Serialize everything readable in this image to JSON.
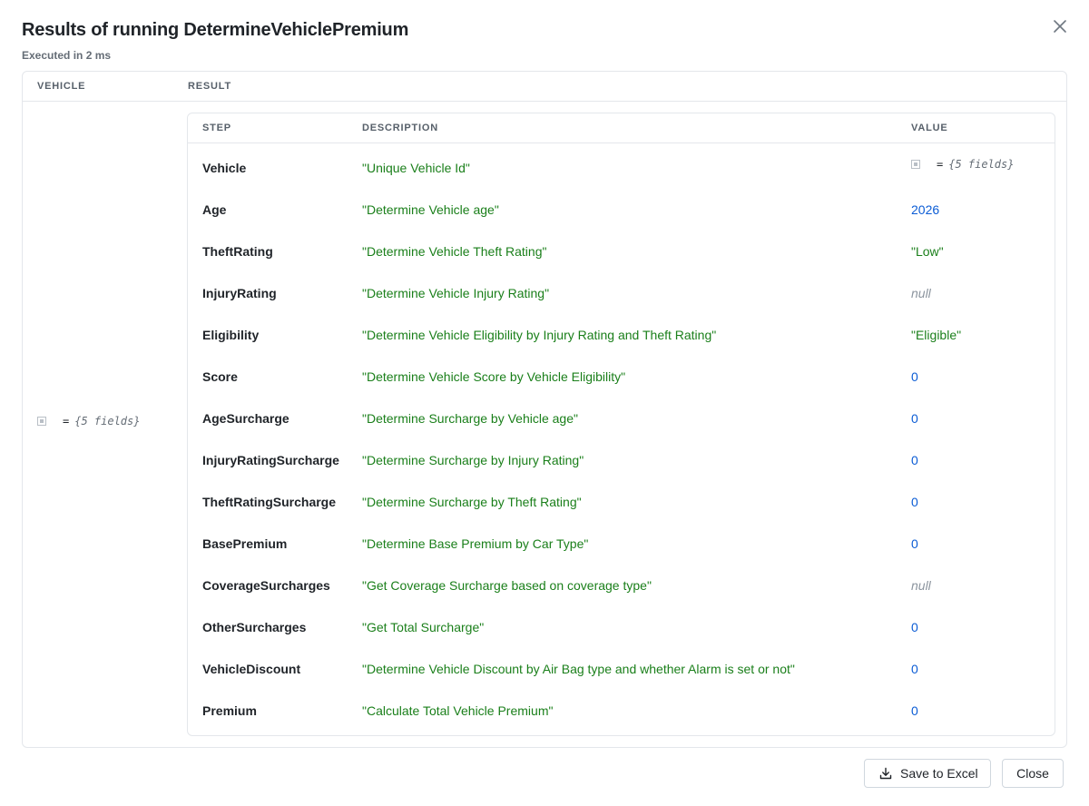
{
  "dialog": {
    "title": "Results of running DetermineVehiclePremium",
    "subtitle": "Executed in 2 ms",
    "close_icon": "close-icon"
  },
  "outer_table": {
    "columns": [
      "VEHICLE",
      "RESULT"
    ],
    "vehicle_value": {
      "eq": "=",
      "summary": "{5 fields}"
    }
  },
  "result_table": {
    "columns": [
      "STEP",
      "DESCRIPTION",
      "VALUE"
    ],
    "rows": [
      {
        "step": "Vehicle",
        "description": "\"Unique Vehicle Id\"",
        "value": "{5 fields}",
        "eq": "=",
        "kind": "obj"
      },
      {
        "step": "Age",
        "description": "\"Determine Vehicle age\"",
        "value": "2026",
        "kind": "num"
      },
      {
        "step": "TheftRating",
        "description": "\"Determine Vehicle Theft Rating\"",
        "value": "\"Low\"",
        "kind": "str"
      },
      {
        "step": "InjuryRating",
        "description": "\"Determine Vehicle Injury Rating\"",
        "value": "null",
        "kind": "null"
      },
      {
        "step": "Eligibility",
        "description": "\"Determine Vehicle Eligibility by Injury Rating and Theft Rating\"",
        "value": "\"Eligible\"",
        "kind": "str"
      },
      {
        "step": "Score",
        "description": "\"Determine Vehicle Score by Vehicle Eligibility\"",
        "value": "0",
        "kind": "num"
      },
      {
        "step": "AgeSurcharge",
        "description": "\"Determine Surcharge by Vehicle age\"",
        "value": "0",
        "kind": "num"
      },
      {
        "step": "InjuryRatingSurcharge",
        "description": "\"Determine Surcharge by Injury Rating\"",
        "value": "0",
        "kind": "num"
      },
      {
        "step": "TheftRatingSurcharge",
        "description": "\"Determine Surcharge by Theft Rating\"",
        "value": "0",
        "kind": "num"
      },
      {
        "step": "BasePremium",
        "description": "\"Determine Base Premium by Car Type\"",
        "value": "0",
        "kind": "num"
      },
      {
        "step": "CoverageSurcharges",
        "description": "\"Get Coverage Surcharge based on coverage type\"",
        "value": "null",
        "kind": "null"
      },
      {
        "step": "OtherSurcharges",
        "description": "\"Get Total Surcharge\"",
        "value": "0",
        "kind": "num"
      },
      {
        "step": "VehicleDiscount",
        "description": "\"Determine Vehicle Discount by Air Bag type and whether Alarm is set or not\"",
        "value": "0",
        "kind": "num"
      },
      {
        "step": "Premium",
        "description": "\"Calculate Total Vehicle Premium\"",
        "value": "0",
        "kind": "num"
      }
    ]
  },
  "footer": {
    "save_label": "Save to Excel",
    "save_icon": "download-icon",
    "close_label": "Close"
  },
  "colors": {
    "string_green": "#1a7f1a",
    "number_blue": "#0b5cd5",
    "null_gray": "#8c959f",
    "border": "#e4e7eb"
  }
}
